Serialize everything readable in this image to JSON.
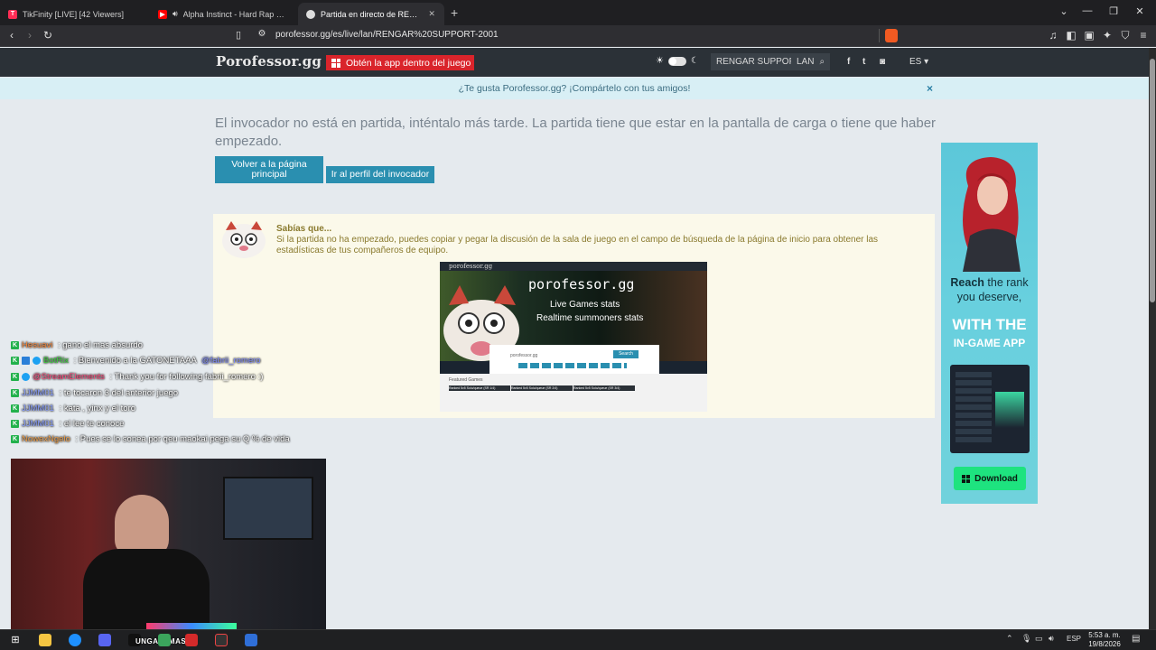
{
  "browser": {
    "tabs": [
      {
        "label": "TikFinity [LIVE] [42 Viewers]",
        "favicon_color": "#ff2d55"
      },
      {
        "label": "Alpha Instinct - Hard Rap Rock W",
        "favicon_color": "#ff0000"
      },
      {
        "label": "Partida en directo de RENGAR S",
        "favicon_color": "#cccccc"
      }
    ],
    "new_tab": "+",
    "url": "porofessor.gg/es/live/lan/RENGAR%20SUPPORT-2001"
  },
  "site": {
    "logo": "Porofessor.gg",
    "app_button": "Obtén la app dentro del juego",
    "search_value": "RENGAR SUPPOF",
    "region": "LAN",
    "language": "ES",
    "share_text": "¿Te gusta Porofessor.gg? ¡Compártelo con tus amigos!",
    "share_close": "×"
  },
  "main": {
    "message": "El invocador no está en partida, inténtalo más tarde. La partida tiene que estar en la pantalla de carga o tiene que haber empezado.",
    "back_button": "Volver a la página principal",
    "profile_button": "Ir al perfil del invocador",
    "tip_title": "Sabías que...",
    "tip_text": "Si la partida no ha empezado, puedes copiar y pegar la discusión de la sala de juego en el campo de búsqueda de la página de inicio para obtener las estadísticas de tus compañeros de equipo.",
    "promo": {
      "logo": "porofessor.gg",
      "line1": "Live Games stats",
      "line2": "Realtime summoners stats",
      "search_placeholder": "porofessor.gg",
      "search_button": "Search",
      "featured": "Featured Games",
      "cols": [
        "Ranked 5v5 Solo/queue (SR 1/4)",
        "Ranked 5v5 Solo/queue (SR 2/4)",
        "Ranked 5v5 Solo/queue (SR 3/4)"
      ]
    }
  },
  "ad": {
    "line1_bold": "Reach",
    "line1_rest": " the rank you deserve,",
    "line2": "WITH THE",
    "line3": "IN-GAME APP",
    "download": "Download"
  },
  "chat": [
    {
      "user": "Hesuavi",
      "user_color": "#ff8a3a",
      "text": " : gano el mas absurdo",
      "badges": [
        "K"
      ]
    },
    {
      "user": "BotRix",
      "user_color": "#3bd13b",
      "text": " : Bienvenido a la GATONETAAA ",
      "mention": "@fabrii_romero",
      "mention_color": "#7f8cff",
      "badges": [
        "K",
        "mod",
        "verified"
      ]
    },
    {
      "user": "@StreamElements",
      "user_color": "#ff4b7d",
      "text": " : Thank you for following fabrii_romero :)",
      "badges": [
        "K",
        "verified"
      ]
    },
    {
      "user": "JJMM01",
      "user_color": "#8aa0ff",
      "text": " : te tocaron 3 del anterior juego",
      "badges": [
        "K"
      ]
    },
    {
      "user": "JJMM01",
      "user_color": "#8aa0ff",
      "text": " : kata , yinx y el toro",
      "badges": [
        "K"
      ]
    },
    {
      "user": "JJMM01",
      "user_color": "#8aa0ff",
      "text": " : el lee te conoce",
      "badges": [
        "K"
      ]
    },
    {
      "user": "NowexNgelo",
      "user_color": "#f0a04b",
      "text": " : Pues se lo sonea por qeu maokai pega su Q % de vida",
      "badges": [
        "K"
      ]
    }
  ],
  "taskbar": {
    "label": "UNGATOMASS",
    "lang": "ESP",
    "time": "5:53 a. m.",
    "date": "19/8/2026"
  }
}
